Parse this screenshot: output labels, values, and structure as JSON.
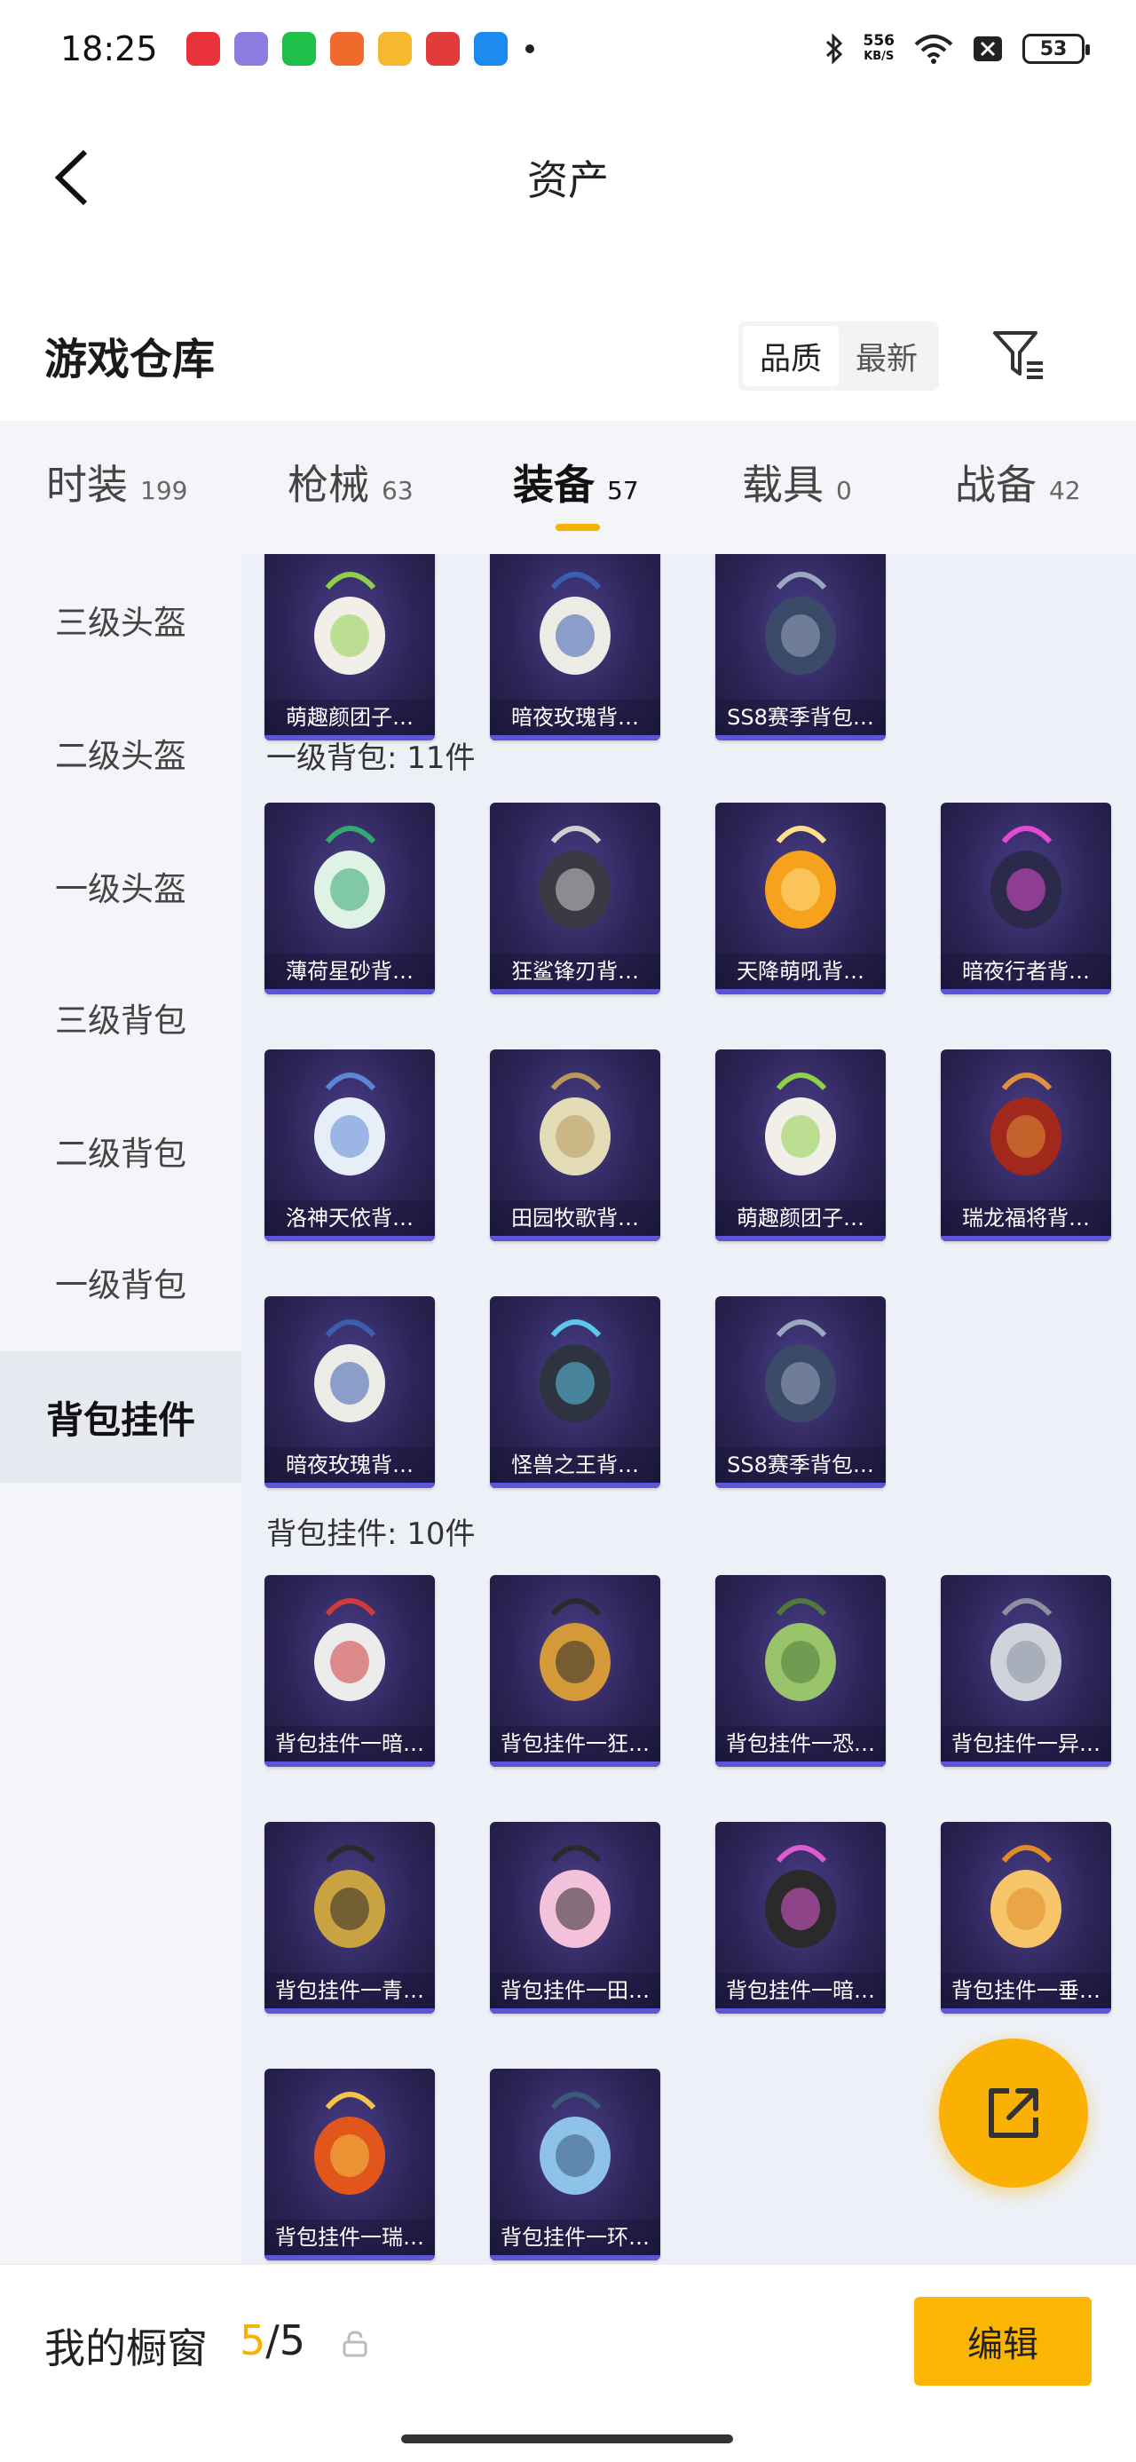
{
  "status_bar": {
    "time": "18:25",
    "net_speed_value": "556",
    "net_speed_unit": "KB/S",
    "battery": "53",
    "app_icon_colors": [
      "#e9323a",
      "#8e7de0",
      "#1fbf4a",
      "#f06a2c",
      "#f5b82e",
      "#e23b3b",
      "#1d8af0"
    ]
  },
  "nav": {
    "title": "资产"
  },
  "header": {
    "title": "游戏仓库",
    "sort_options": [
      "品质",
      "最新"
    ],
    "active_sort": "品质"
  },
  "category_tabs": [
    {
      "label": "时装",
      "count": "199"
    },
    {
      "label": "枪械",
      "count": "63"
    },
    {
      "label": "装备",
      "count": "57"
    },
    {
      "label": "载具",
      "count": "0"
    },
    {
      "label": "战备",
      "count": "42"
    }
  ],
  "active_tab": "装备",
  "sidebar": {
    "items": [
      "三级头盔",
      "二级头盔",
      "一级头盔",
      "三级背包",
      "二级背包",
      "一级背包",
      "背包挂件"
    ],
    "active": "背包挂件"
  },
  "sections": [
    {
      "title": "",
      "items": [
        {
          "name": "萌趣颜团子…",
          "icon": "white-bunny-backpack"
        },
        {
          "name": "暗夜玫瑰背…",
          "icon": "white-bear-backpack"
        },
        {
          "name": "SS8赛季背包…",
          "icon": "navy-backpack"
        }
      ]
    },
    {
      "title": "一级背包: 11件",
      "items": [
        {
          "name": "薄荷星砂背…",
          "icon": "mint-bag"
        },
        {
          "name": "狂鲨锋刃背…",
          "icon": "shark-backpack"
        },
        {
          "name": "天降萌吼背…",
          "icon": "orange-backpack"
        },
        {
          "name": "暗夜行者背…",
          "icon": "dark-walker-backpack"
        },
        {
          "name": "洛神天依背…",
          "icon": "blue-white-backpack"
        },
        {
          "name": "田园牧歌背…",
          "icon": "basket-backpack"
        },
        {
          "name": "萌趣颜团子…",
          "icon": "white-bunny-backpack"
        },
        {
          "name": "瑞龙福将背…",
          "icon": "red-armor-backpack"
        },
        {
          "name": "暗夜玫瑰背…",
          "icon": "white-bear-backpack"
        },
        {
          "name": "怪兽之王背…",
          "icon": "monster-backpack"
        },
        {
          "name": "SS8赛季背包…",
          "icon": "navy-backpack"
        }
      ]
    },
    {
      "title": "背包挂件: 10件",
      "items": [
        {
          "name": "背包挂件一暗…",
          "icon": "bunny-charm"
        },
        {
          "name": "背包挂件一狂…",
          "icon": "fin-charm"
        },
        {
          "name": "背包挂件一恐…",
          "icon": "egg-charm"
        },
        {
          "name": "背包挂件一异…",
          "icon": "wing-charm"
        },
        {
          "name": "背包挂件一青…",
          "icon": "gold-coil-charm"
        },
        {
          "name": "背包挂件一田…",
          "icon": "card-charm"
        },
        {
          "name": "背包挂件一暗…",
          "icon": "black-bird-charm"
        },
        {
          "name": "背包挂件一垂…",
          "icon": "duck-charm"
        },
        {
          "name": "背包挂件一瑞…",
          "icon": "lantern-charm"
        },
        {
          "name": "背包挂件一环…",
          "icon": "ring-charm"
        }
      ]
    }
  ],
  "bottom_bar": {
    "label": "我的橱窗",
    "used": "5",
    "separator": "/",
    "total": "5",
    "edit_label": "编辑"
  },
  "colors": {
    "accent": "#f7b100",
    "card_bg": "#2c2456",
    "card_edge": "#5d55d8"
  }
}
